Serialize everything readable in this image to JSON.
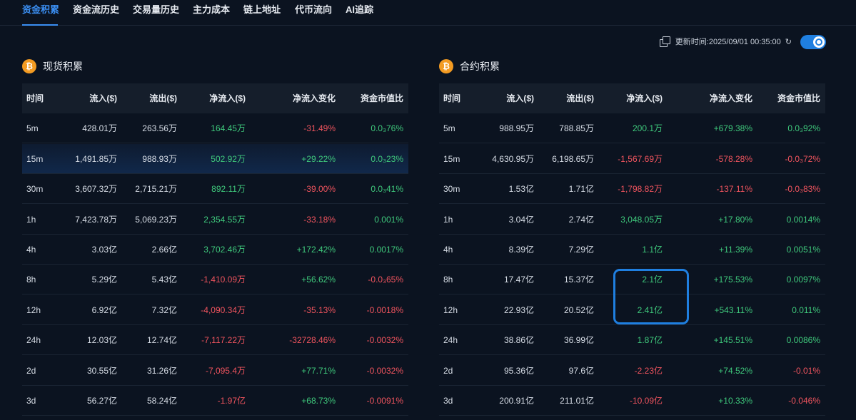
{
  "tabs": [
    {
      "label": "资金积累",
      "active": true
    },
    {
      "label": "资金流历史",
      "active": false
    },
    {
      "label": "交易量历史",
      "active": false
    },
    {
      "label": "主力成本",
      "active": false
    },
    {
      "label": "链上地址",
      "active": false
    },
    {
      "label": "代币流向",
      "active": false
    },
    {
      "label": "AI追踪",
      "active": false
    }
  ],
  "topbar": {
    "update_label": "更新时间:2025/09/01 00:35:00",
    "refresh_icon": "refresh-icon",
    "copy_icon": "copy-icon",
    "toggle_on": true
  },
  "colors": {
    "accent": "#3b8ff3",
    "positive": "#3fc97c",
    "negative": "#f0545e",
    "btc": "#f39b22"
  },
  "columns": [
    "时间",
    "流入($)",
    "流出($)",
    "净流入($)",
    "净流入变化",
    "资金市值比"
  ],
  "spot": {
    "title": "现货积累",
    "icon": "bitcoin-icon",
    "rows": [
      {
        "time": "5m",
        "inflow": "428.01万",
        "outflow": "263.56万",
        "net": "164.45万",
        "net_dir": "pos",
        "change": "-31.49%",
        "change_dir": "neg",
        "ratio": "0.0₃76%",
        "ratio_dir": "pos"
      },
      {
        "time": "15m",
        "inflow": "1,491.85万",
        "outflow": "988.93万",
        "net": "502.92万",
        "net_dir": "pos",
        "change": "+29.22%",
        "change_dir": "pos",
        "ratio": "0.0₃23%",
        "ratio_dir": "pos"
      },
      {
        "time": "30m",
        "inflow": "3,607.32万",
        "outflow": "2,715.21万",
        "net": "892.11万",
        "net_dir": "pos",
        "change": "-39.00%",
        "change_dir": "neg",
        "ratio": "0.0₃41%",
        "ratio_dir": "pos"
      },
      {
        "time": "1h",
        "inflow": "7,423.78万",
        "outflow": "5,069.23万",
        "net": "2,354.55万",
        "net_dir": "pos",
        "change": "-33.18%",
        "change_dir": "neg",
        "ratio": "0.001%",
        "ratio_dir": "pos"
      },
      {
        "time": "4h",
        "inflow": "3.03亿",
        "outflow": "2.66亿",
        "net": "3,702.46万",
        "net_dir": "pos",
        "change": "+172.42%",
        "change_dir": "pos",
        "ratio": "0.0017%",
        "ratio_dir": "pos"
      },
      {
        "time": "8h",
        "inflow": "5.29亿",
        "outflow": "5.43亿",
        "net": "-1,410.09万",
        "net_dir": "neg",
        "change": "+56.62%",
        "change_dir": "pos",
        "ratio": "-0.0₃65%",
        "ratio_dir": "neg"
      },
      {
        "time": "12h",
        "inflow": "6.92亿",
        "outflow": "7.32亿",
        "net": "-4,090.34万",
        "net_dir": "neg",
        "change": "-35.13%",
        "change_dir": "neg",
        "ratio": "-0.0018%",
        "ratio_dir": "neg"
      },
      {
        "time": "24h",
        "inflow": "12.03亿",
        "outflow": "12.74亿",
        "net": "-7,117.22万",
        "net_dir": "neg",
        "change": "-32728.46%",
        "change_dir": "neg",
        "ratio": "-0.0032%",
        "ratio_dir": "neg"
      },
      {
        "time": "2d",
        "inflow": "30.55亿",
        "outflow": "31.26亿",
        "net": "-7,095.4万",
        "net_dir": "neg",
        "change": "+77.71%",
        "change_dir": "pos",
        "ratio": "-0.0032%",
        "ratio_dir": "neg"
      },
      {
        "time": "3d",
        "inflow": "56.27亿",
        "outflow": "58.24亿",
        "net": "-1.97亿",
        "net_dir": "neg",
        "change": "+68.73%",
        "change_dir": "pos",
        "ratio": "-0.0091%",
        "ratio_dir": "neg"
      }
    ]
  },
  "futures": {
    "title": "合约积累",
    "icon": "bitcoin-icon",
    "rows": [
      {
        "time": "5m",
        "inflow": "988.95万",
        "outflow": "788.85万",
        "net": "200.1万",
        "net_dir": "pos",
        "change": "+679.38%",
        "change_dir": "pos",
        "ratio": "0.0₃92%",
        "ratio_dir": "pos"
      },
      {
        "time": "15m",
        "inflow": "4,630.95万",
        "outflow": "6,198.65万",
        "net": "-1,567.69万",
        "net_dir": "neg",
        "change": "-578.28%",
        "change_dir": "neg",
        "ratio": "-0.0₃72%",
        "ratio_dir": "neg"
      },
      {
        "time": "30m",
        "inflow": "1.53亿",
        "outflow": "1.71亿",
        "net": "-1,798.82万",
        "net_dir": "neg",
        "change": "-137.11%",
        "change_dir": "neg",
        "ratio": "-0.0₃83%",
        "ratio_dir": "neg"
      },
      {
        "time": "1h",
        "inflow": "3.04亿",
        "outflow": "2.74亿",
        "net": "3,048.05万",
        "net_dir": "pos",
        "change": "+17.80%",
        "change_dir": "pos",
        "ratio": "0.0014%",
        "ratio_dir": "pos"
      },
      {
        "time": "4h",
        "inflow": "8.39亿",
        "outflow": "7.29亿",
        "net": "1.1亿",
        "net_dir": "pos",
        "change": "+11.39%",
        "change_dir": "pos",
        "ratio": "0.0051%",
        "ratio_dir": "pos"
      },
      {
        "time": "8h",
        "inflow": "17.47亿",
        "outflow": "15.37亿",
        "net": "2.1亿",
        "net_dir": "pos",
        "change": "+175.53%",
        "change_dir": "pos",
        "ratio": "0.0097%",
        "ratio_dir": "pos"
      },
      {
        "time": "12h",
        "inflow": "22.93亿",
        "outflow": "20.52亿",
        "net": "2.41亿",
        "net_dir": "pos",
        "change": "+543.11%",
        "change_dir": "pos",
        "ratio": "0.011%",
        "ratio_dir": "pos"
      },
      {
        "time": "24h",
        "inflow": "38.86亿",
        "outflow": "36.99亿",
        "net": "1.87亿",
        "net_dir": "pos",
        "change": "+145.51%",
        "change_dir": "pos",
        "ratio": "0.0086%",
        "ratio_dir": "pos"
      },
      {
        "time": "2d",
        "inflow": "95.36亿",
        "outflow": "97.6亿",
        "net": "-2.23亿",
        "net_dir": "neg",
        "change": "+74.52%",
        "change_dir": "pos",
        "ratio": "-0.01%",
        "ratio_dir": "neg"
      },
      {
        "time": "3d",
        "inflow": "200.91亿",
        "outflow": "211.01亿",
        "net": "-10.09亿",
        "net_dir": "neg",
        "change": "+10.33%",
        "change_dir": "pos",
        "ratio": "-0.046%",
        "ratio_dir": "neg"
      }
    ]
  }
}
